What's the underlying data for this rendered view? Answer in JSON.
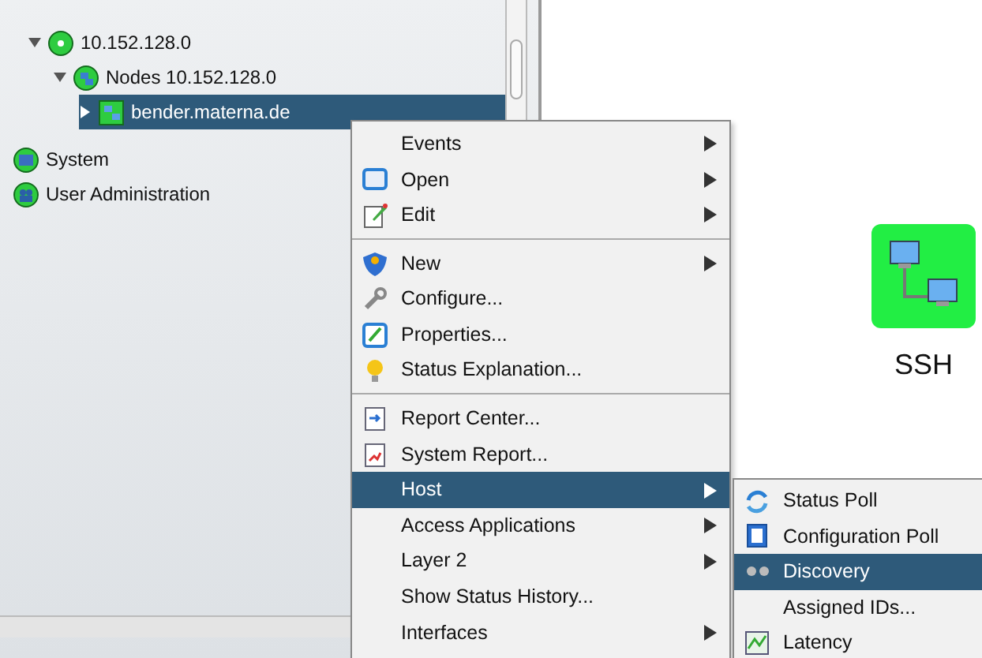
{
  "tree": [
    {
      "label": "10.152.128.0",
      "expanded": true,
      "selected": false,
      "children": [
        {
          "label": "Nodes 10.152.128.0",
          "expanded": true,
          "selected": false,
          "children": [
            {
              "label": "bender.materna.de",
              "expanded": false,
              "selected": true
            }
          ]
        }
      ]
    },
    {
      "label": "System",
      "selected": false
    },
    {
      "label": "User Administration",
      "selected": false
    }
  ],
  "context_menu": [
    {
      "kind": "item",
      "label": "Events",
      "submenu": true,
      "selected": false
    },
    {
      "kind": "item",
      "label": "Open",
      "submenu": true,
      "selected": false
    },
    {
      "kind": "item",
      "label": "Edit",
      "submenu": true,
      "selected": false
    },
    {
      "kind": "separator"
    },
    {
      "kind": "item",
      "label": "New",
      "submenu": true,
      "selected": false
    },
    {
      "kind": "item",
      "label": "Configure...",
      "submenu": false,
      "selected": false
    },
    {
      "kind": "item",
      "label": "Properties...",
      "submenu": false,
      "selected": false
    },
    {
      "kind": "item",
      "label": "Status Explanation...",
      "submenu": false,
      "selected": false
    },
    {
      "kind": "separator"
    },
    {
      "kind": "item",
      "label": "Report Center...",
      "submenu": false,
      "selected": false
    },
    {
      "kind": "item",
      "label": "System Report...",
      "submenu": false,
      "selected": false
    },
    {
      "kind": "item",
      "label": "Host",
      "submenu": true,
      "selected": true
    },
    {
      "kind": "item",
      "label": "Access Applications",
      "submenu": true,
      "selected": false
    },
    {
      "kind": "item",
      "label": "Layer 2",
      "submenu": true,
      "selected": false
    },
    {
      "kind": "item",
      "label": "Show Status History...",
      "submenu": false,
      "selected": false
    },
    {
      "kind": "item",
      "label": "Interfaces",
      "submenu": true,
      "selected": false
    }
  ],
  "host_submenu": [
    {
      "label": "Status Poll",
      "selected": false
    },
    {
      "label": "Configuration Poll",
      "selected": false
    },
    {
      "label": "Discovery",
      "selected": true
    },
    {
      "label": "Assigned IDs...",
      "selected": false
    },
    {
      "label": "Latency",
      "selected": false
    }
  ],
  "service": {
    "label": "SSH",
    "color": "#22ee44"
  }
}
